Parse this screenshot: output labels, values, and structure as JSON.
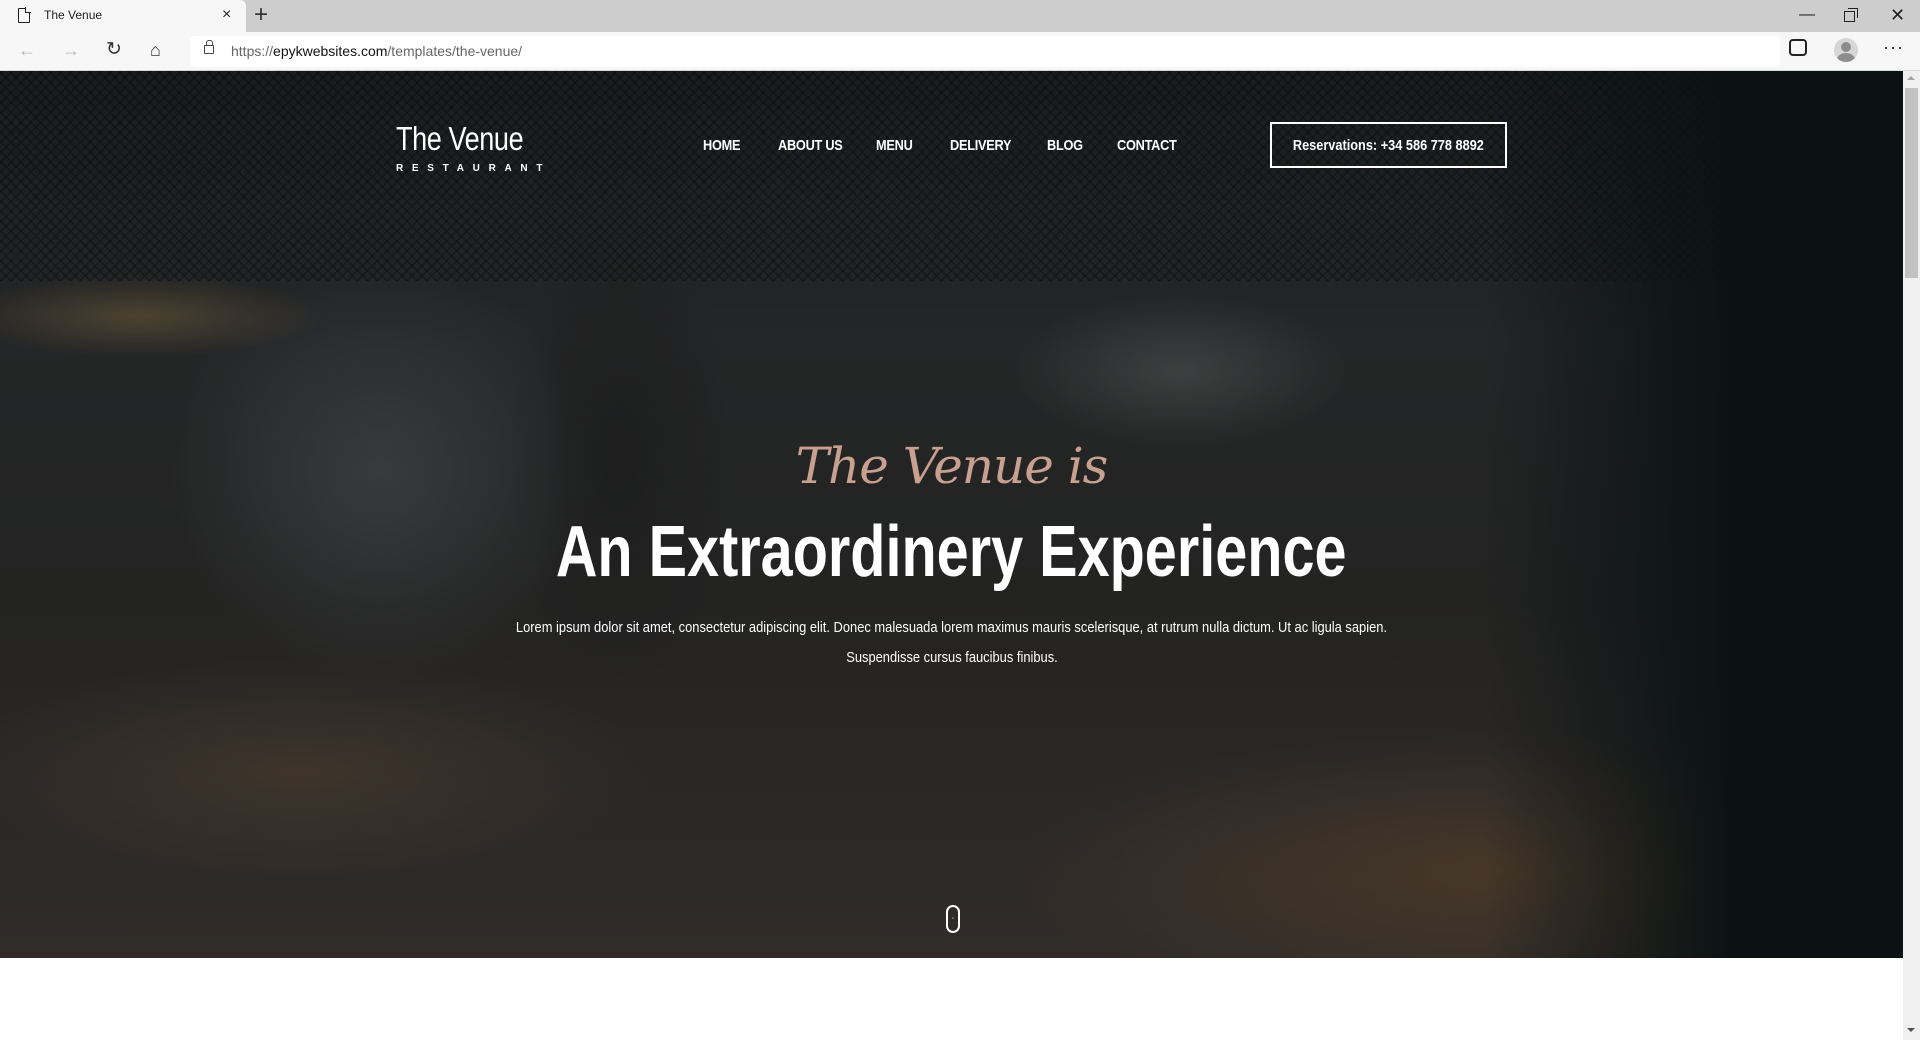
{
  "browser": {
    "tab_title": "The Venue",
    "url_scheme": "https://",
    "url_host": "epykwebsites.com",
    "url_path": "/templates/the-venue/",
    "icons": {
      "tab": "page-icon",
      "close": "×",
      "new_tab": "+",
      "back": "←",
      "forward": "→",
      "reload": "↻",
      "home": "⌂",
      "favorites": "☆",
      "more": "···",
      "minimize": "—",
      "close_window": "✕"
    }
  },
  "site": {
    "logo_title": "The Venue",
    "logo_subtitle": "RESTAURANT",
    "nav": [
      "HOME",
      "ABOUT US",
      "MENU",
      "DELIVERY",
      "BLOG",
      "CONTACT"
    ],
    "reservation_label": "Reservations: +34 586 778 8892",
    "hero": {
      "script": "The Venue is",
      "headline": "An Extraordinery Experience",
      "lede_line1": "Lorem ipsum dolor sit amet, consectetur adipiscing elit. Donec malesuada lorem maximus mauris scelerisque, at rutrum nulla dictum. Ut ac ligula sapien.",
      "lede_line2": "Suspendisse cursus faucibus finibus."
    },
    "colors": {
      "script_accent": "#c8a090",
      "hero_dark": "#0b1213",
      "text": "#ffffff"
    }
  }
}
